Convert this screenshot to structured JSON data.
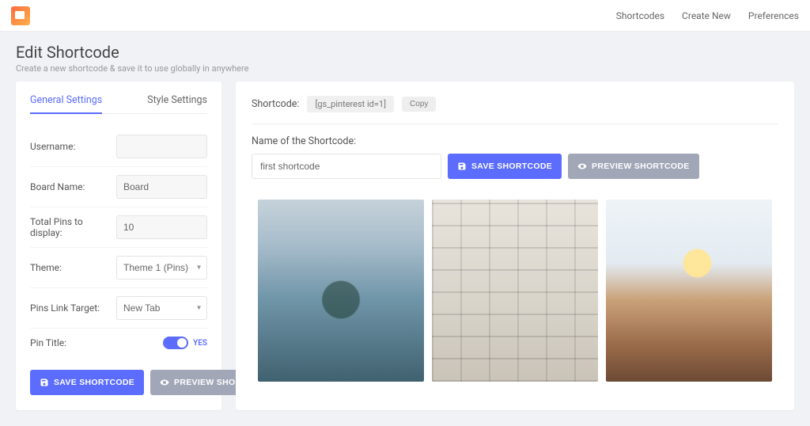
{
  "nav": {
    "items": [
      "Shortcodes",
      "Create New",
      "Preferences"
    ]
  },
  "page": {
    "title": "Edit Shortcode",
    "subtitle": "Create a new shortcode & save it to use globally in anywhere"
  },
  "tabs": {
    "general": "General Settings",
    "style": "Style Settings"
  },
  "form": {
    "username_label": "Username:",
    "username_value": "",
    "board_label": "Board Name:",
    "board_value": "Board",
    "total_label": "Total Pins to display:",
    "total_value": "10",
    "theme_label": "Theme:",
    "theme_value": "Theme 1 (Pins)",
    "target_label": "Pins Link Target:",
    "target_value": "New Tab",
    "pintitle_label": "Pin Title:",
    "toggle_text": "YES"
  },
  "buttons": {
    "save": "Save Shortcode",
    "preview": "Preview Shortcode"
  },
  "shortcode": {
    "label": "Shortcode:",
    "code": "[gs_pinterest id=1]",
    "copy": "Copy"
  },
  "nameField": {
    "label": "Name of the Shortcode:",
    "value": "first shortcode"
  }
}
